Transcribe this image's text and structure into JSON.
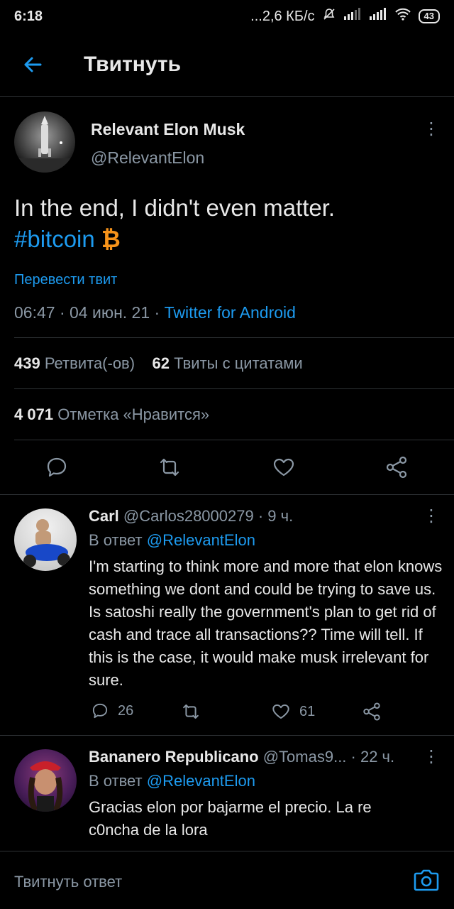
{
  "status_bar": {
    "time": "6:18",
    "network": "...2,6 КБ/с",
    "battery": "43"
  },
  "topbar": {
    "back_icon": "arrow-left-icon",
    "title": "Твитнуть"
  },
  "tweet": {
    "author_name": "Relevant Elon Musk",
    "author_handle": "@RelevantElon",
    "text": "In the end, I didn't even matter.",
    "hashtag": "#bitcoin",
    "emoji": "₿",
    "translate": "Перевести твит",
    "timestamp": "06:47 · 04 июн. 21 · ",
    "source": "Twitter for Android",
    "retweets_count": "439",
    "retweets_label": "Ретвита(-ов)",
    "quotes_count": "62",
    "quotes_label": "Твиты с цитатами",
    "likes_count": "4 071",
    "likes_label": "Отметка «Нравится»"
  },
  "replies": [
    {
      "name": "Carl",
      "handle": "@Carlos28000279",
      "time": " · 9 ч.",
      "in_reply_prefix": "В ответ ",
      "in_reply_to": "@RelevantElon",
      "text": "I'm starting to think more and more that elon knows something we dont and could be trying to save us. Is satoshi really the government's plan to get rid of cash and trace all transactions?? Time will tell. If this is the case, it would make musk irrelevant for sure.",
      "reply_count": "26",
      "like_count": "61"
    },
    {
      "name": "Bananero Republicano",
      "handle": "@Tomas9...",
      "time": " · 22 ч.",
      "in_reply_prefix": "В ответ ",
      "in_reply_to": "@RelevantElon",
      "text": "Gracias elon por bajarme el precio. La re c0ncha de la lora"
    }
  ],
  "compose": {
    "placeholder": "Твитнуть ответ",
    "camera_icon": "camera-icon"
  },
  "colors": {
    "background": "#000000",
    "accent": "#1d9bf0",
    "secondary_text": "#8b98a5",
    "bitcoin": "#f7931a"
  }
}
